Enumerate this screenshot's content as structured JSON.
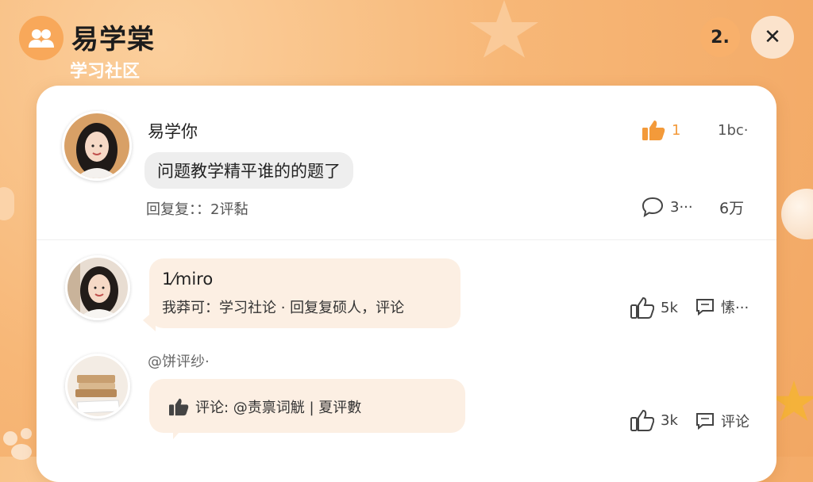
{
  "header": {
    "title": "易学棠",
    "subtitle": "学习社区",
    "badge": "2.",
    "close": "✕"
  },
  "posts": [
    {
      "author": "易学你",
      "text": "问题教学精平谁的的题了",
      "like_count": "1",
      "top_right": "1bc·",
      "replies": "回复复：：2评黏",
      "comment_count": "3···",
      "views": "6万"
    }
  ],
  "comments": [
    {
      "author": "1⁄miro",
      "text": "我莽可：学习社论 · 回复复硕人，评论",
      "like_count": "5k",
      "action": "愫···"
    },
    {
      "mention": "@饼评纱·",
      "text": "评论: @责禀词觥 | 夏评數",
      "like_count": "3k",
      "action": "评论"
    }
  ],
  "icons": {
    "logo": "users-icon",
    "like": "thumbs-up-icon",
    "comment": "comment-bubble-icon",
    "message": "message-square-icon"
  },
  "colors": {
    "accent": "#f39a3a",
    "background": "#f7b777",
    "card": "#ffffff",
    "bubble_peach": "#fcefe3"
  }
}
